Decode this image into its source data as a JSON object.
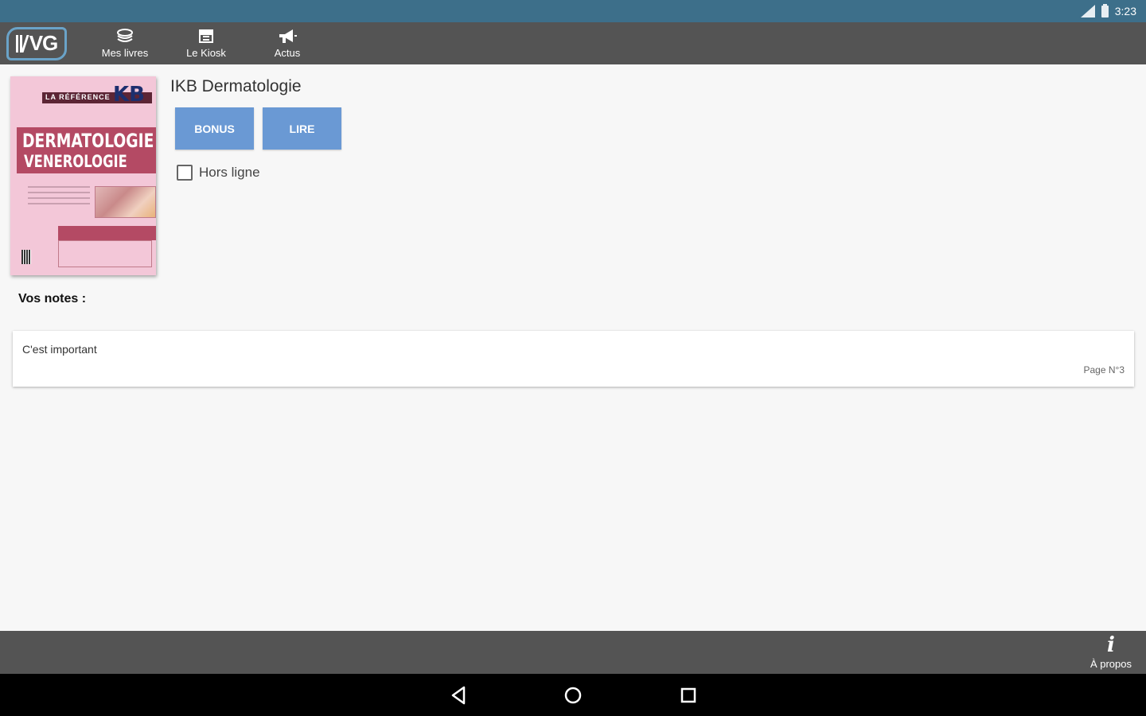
{
  "status_bar": {
    "time": "3:23",
    "icons": [
      "signal-icon",
      "battery-icon"
    ]
  },
  "toolbar": {
    "logo_text": "VG",
    "nav": [
      {
        "label": "Mes livres",
        "icon": "books-icon"
      },
      {
        "label": "Le Kiosk",
        "icon": "kiosk-icon"
      },
      {
        "label": "Actus",
        "icon": "megaphone-icon"
      }
    ]
  },
  "book": {
    "title": "IKB Dermatologie",
    "cover": {
      "series": "LA RÉFÉRENCE",
      "brand": "KB",
      "line1": "DERMATOLOGIE",
      "line2": "VENEROLOGIE"
    },
    "bonus_label": "BONUS",
    "read_label": "LIRE",
    "offline_label": "Hors ligne",
    "offline_checked": false
  },
  "notes": {
    "label": "Vos notes :",
    "items": [
      {
        "text": "C'est important",
        "page": "Page N°3"
      }
    ]
  },
  "bottom_bar": {
    "about_label": "À propos",
    "about_icon": "info-icon"
  },
  "colors": {
    "status_bar": "#3d6f8a",
    "toolbar": "#545454",
    "button": "#6a99d4",
    "cover": "#f3c7d8"
  }
}
